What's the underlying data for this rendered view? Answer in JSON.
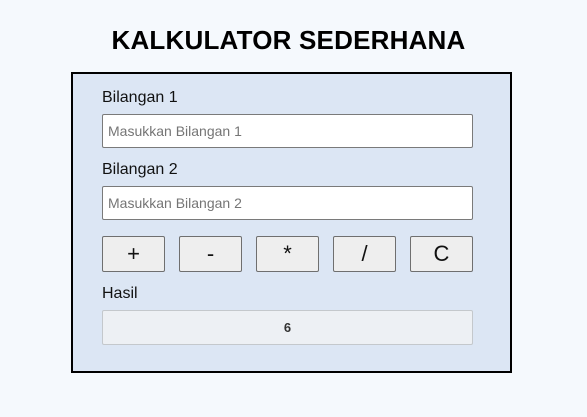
{
  "title": "KALKULATOR SEDERHANA",
  "form": {
    "bilangan1": {
      "label": "Bilangan 1",
      "placeholder": "Masukkan Bilangan 1",
      "value": ""
    },
    "bilangan2": {
      "label": "Bilangan 2",
      "placeholder": "Masukkan Bilangan 2",
      "value": ""
    },
    "buttons": {
      "add": "+",
      "subtract": "-",
      "multiply": "*",
      "divide": "/",
      "clear": "C"
    },
    "result": {
      "label": "Hasil",
      "value": "6"
    }
  },
  "colors": {
    "page_background": "#f5f9fd",
    "card_background": "#dce6f4",
    "card_border": "#000000",
    "button_background": "#eeeeee",
    "result_background": "#edf0f4"
  }
}
